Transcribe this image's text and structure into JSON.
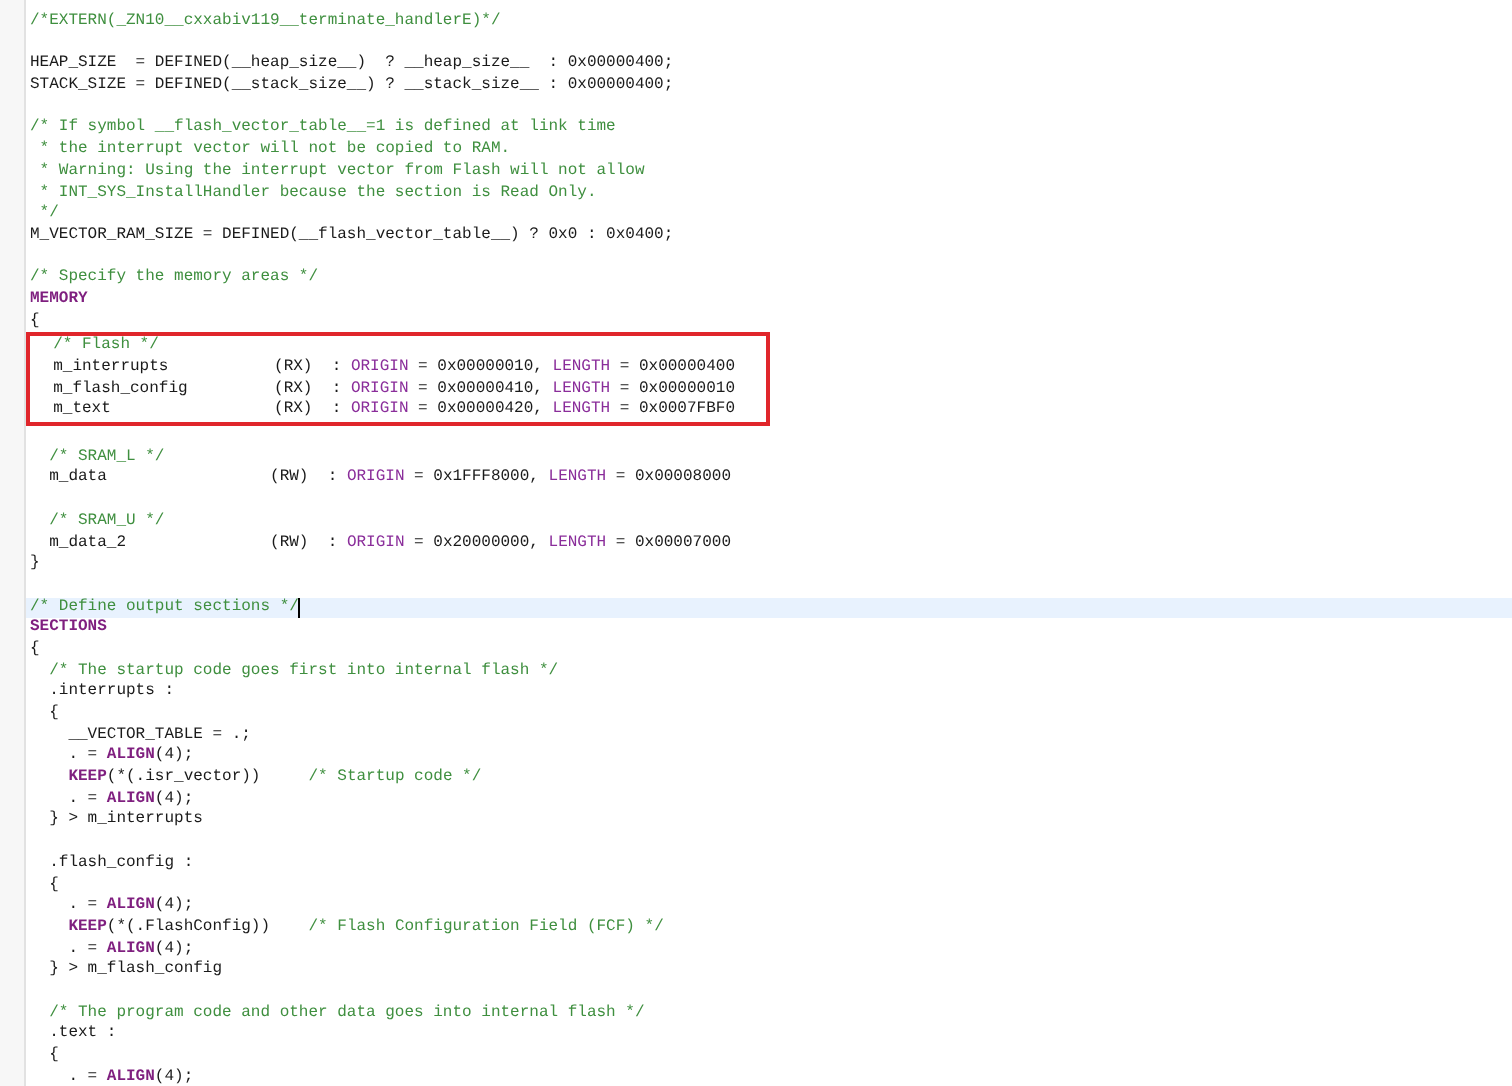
{
  "editor": {
    "lines": [
      {
        "segments": [
          {
            "kind": "comment",
            "text": "/*EXTERN(_ZN10__cxxabiv119__terminate_handlerE)*/"
          }
        ]
      },
      {
        "blank_before": true,
        "segments": [
          {
            "kind": "plain",
            "text": "HEAP_SIZE  = DEFINED(__heap_size__)  ? __heap_size__  : 0x00000400;"
          }
        ]
      },
      {
        "segments": [
          {
            "kind": "plain",
            "text": "STACK_SIZE = DEFINED(__stack_size__) ? __stack_size__ : 0x00000400;"
          }
        ]
      },
      {
        "blank_before": true,
        "segments": [
          {
            "kind": "comment",
            "text": "/* If symbol __flash_vector_table__=1 is defined at link time"
          }
        ]
      },
      {
        "segments": [
          {
            "kind": "comment",
            "text": " * the interrupt vector will not be copied to RAM."
          }
        ]
      },
      {
        "segments": [
          {
            "kind": "comment",
            "text": " * Warning: Using the interrupt vector from Flash will not allow"
          }
        ]
      },
      {
        "segments": [
          {
            "kind": "comment",
            "text": " * INT_SYS_InstallHandler because the section is Read Only."
          }
        ]
      },
      {
        "segments": [
          {
            "kind": "comment",
            "text": " */"
          }
        ]
      },
      {
        "segments": [
          {
            "kind": "plain",
            "text": "M_VECTOR_RAM_SIZE = DEFINED(__flash_vector_table__) ? 0x0 : 0x0400;"
          }
        ]
      },
      {
        "blank_before": true,
        "segments": [
          {
            "kind": "comment",
            "text": "/* Specify the memory areas */"
          }
        ]
      },
      {
        "segments": [
          {
            "kind": "keyword",
            "text": "MEMORY"
          }
        ]
      },
      {
        "segments": [
          {
            "kind": "plain",
            "text": "{"
          }
        ]
      },
      {
        "boxed": true,
        "segments": [
          {
            "kind": "comment",
            "text": "  /* Flash */"
          }
        ]
      },
      {
        "boxed": true,
        "segments": [
          {
            "kind": "plain",
            "text": "  m_interrupts           (RX)  : "
          },
          {
            "kind": "attribute",
            "text": "ORIGIN"
          },
          {
            "kind": "plain",
            "text": " = 0x00000010, "
          },
          {
            "kind": "attribute",
            "text": "LENGTH"
          },
          {
            "kind": "plain",
            "text": " = 0x00000400"
          }
        ]
      },
      {
        "boxed": true,
        "segments": [
          {
            "kind": "plain",
            "text": "  m_flash_config         (RX)  : "
          },
          {
            "kind": "attribute",
            "text": "ORIGIN"
          },
          {
            "kind": "plain",
            "text": " = 0x00000410, "
          },
          {
            "kind": "attribute",
            "text": "LENGTH"
          },
          {
            "kind": "plain",
            "text": " = 0x00000010"
          }
        ]
      },
      {
        "boxed": true,
        "segments": [
          {
            "kind": "plain",
            "text": "  m_text                 (RX)  : "
          },
          {
            "kind": "attribute",
            "text": "ORIGIN"
          },
          {
            "kind": "plain",
            "text": " = 0x00000420, "
          },
          {
            "kind": "attribute",
            "text": "LENGTH"
          },
          {
            "kind": "plain",
            "text": " = 0x0007FBF0"
          }
        ]
      },
      {
        "blank_before": true,
        "segments": [
          {
            "kind": "comment",
            "text": "  /* SRAM_L */"
          }
        ]
      },
      {
        "segments": [
          {
            "kind": "plain",
            "text": "  m_data                 (RW)  : "
          },
          {
            "kind": "attribute",
            "text": "ORIGIN"
          },
          {
            "kind": "plain",
            "text": " = 0x1FFF8000, "
          },
          {
            "kind": "attribute",
            "text": "LENGTH"
          },
          {
            "kind": "plain",
            "text": " = 0x00008000"
          }
        ]
      },
      {
        "blank_before": true,
        "segments": [
          {
            "kind": "comment",
            "text": "  /* SRAM_U */"
          }
        ]
      },
      {
        "segments": [
          {
            "kind": "plain",
            "text": "  m_data_2               (RW)  : "
          },
          {
            "kind": "attribute",
            "text": "ORIGIN"
          },
          {
            "kind": "plain",
            "text": " = 0x20000000, "
          },
          {
            "kind": "attribute",
            "text": "LENGTH"
          },
          {
            "kind": "plain",
            "text": " = 0x00007000"
          }
        ]
      },
      {
        "segments": [
          {
            "kind": "plain",
            "text": "}"
          }
        ]
      },
      {
        "blank_before": true,
        "cursor": true,
        "segments": [
          {
            "kind": "comment",
            "text": "/* Define output sections */"
          }
        ]
      },
      {
        "segments": [
          {
            "kind": "keyword",
            "text": "SECTIONS"
          }
        ]
      },
      {
        "segments": [
          {
            "kind": "plain",
            "text": "{"
          }
        ]
      },
      {
        "segments": [
          {
            "kind": "comment",
            "text": "  /* The startup code goes first into internal flash */"
          }
        ]
      },
      {
        "segments": [
          {
            "kind": "plain",
            "text": "  .interrupts :"
          }
        ]
      },
      {
        "segments": [
          {
            "kind": "plain",
            "text": "  {"
          }
        ]
      },
      {
        "segments": [
          {
            "kind": "plain",
            "text": "    __VECTOR_TABLE = .;"
          }
        ]
      },
      {
        "segments": [
          {
            "kind": "plain",
            "text": "    . = "
          },
          {
            "kind": "keyword",
            "text": "ALIGN"
          },
          {
            "kind": "plain",
            "text": "(4);"
          }
        ]
      },
      {
        "segments": [
          {
            "kind": "keyword",
            "text": "    KEEP"
          },
          {
            "kind": "plain",
            "text": "(*(.isr_vector))     "
          },
          {
            "kind": "comment",
            "text": "/* Startup code */"
          }
        ]
      },
      {
        "segments": [
          {
            "kind": "plain",
            "text": "    . = "
          },
          {
            "kind": "keyword",
            "text": "ALIGN"
          },
          {
            "kind": "plain",
            "text": "(4);"
          }
        ]
      },
      {
        "segments": [
          {
            "kind": "plain",
            "text": "  } > m_interrupts"
          }
        ]
      },
      {
        "blank_before": true,
        "segments": [
          {
            "kind": "plain",
            "text": "  .flash_config :"
          }
        ]
      },
      {
        "segments": [
          {
            "kind": "plain",
            "text": "  {"
          }
        ]
      },
      {
        "segments": [
          {
            "kind": "plain",
            "text": "    . = "
          },
          {
            "kind": "keyword",
            "text": "ALIGN"
          },
          {
            "kind": "plain",
            "text": "(4);"
          }
        ]
      },
      {
        "segments": [
          {
            "kind": "keyword",
            "text": "    KEEP"
          },
          {
            "kind": "plain",
            "text": "(*(.FlashConfig))    "
          },
          {
            "kind": "comment",
            "text": "/* Flash Configuration Field (FCF) */"
          }
        ]
      },
      {
        "segments": [
          {
            "kind": "plain",
            "text": "    . = "
          },
          {
            "kind": "keyword",
            "text": "ALIGN"
          },
          {
            "kind": "plain",
            "text": "(4);"
          }
        ]
      },
      {
        "segments": [
          {
            "kind": "plain",
            "text": "  } > m_flash_config"
          }
        ]
      },
      {
        "blank_before": true,
        "segments": [
          {
            "kind": "comment",
            "text": "  /* The program code and other data goes into internal flash */"
          }
        ]
      },
      {
        "segments": [
          {
            "kind": "plain",
            "text": "  .text :"
          }
        ]
      },
      {
        "segments": [
          {
            "kind": "plain",
            "text": "  {"
          }
        ]
      },
      {
        "segments": [
          {
            "kind": "plain",
            "text": "    . = "
          },
          {
            "kind": "keyword",
            "text": "ALIGN"
          },
          {
            "kind": "plain",
            "text": "(4);"
          }
        ]
      }
    ]
  }
}
